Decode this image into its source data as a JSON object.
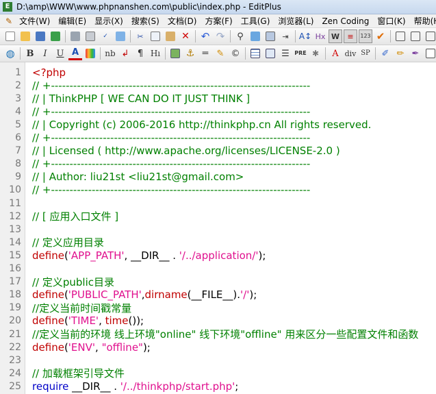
{
  "window": {
    "title": "D:\\amp\\WWW\\www.phpnanshen.com\\public\\index.php - EditPlus"
  },
  "menu": [
    {
      "label": "文件(W)"
    },
    {
      "label": "编辑(E)"
    },
    {
      "label": "显示(X)"
    },
    {
      "label": "搜索(S)"
    },
    {
      "label": "文档(D)"
    },
    {
      "label": "方案(F)"
    },
    {
      "label": "工具(G)"
    },
    {
      "label": "浏览器(L)"
    },
    {
      "label": "Zen Coding"
    },
    {
      "label": "窗口(K)"
    },
    {
      "label": "帮助(H)"
    }
  ],
  "toolbar2_text": {
    "bold": "B",
    "italic": "I",
    "underline": "U",
    "font_color": "A",
    "nbsp": "nb",
    "pilcrow": "¶",
    "heading": "Hı",
    "pre": "PRE",
    "hx": "Hx",
    "div": "div",
    "sp": "SP"
  },
  "icons": {
    "app": "editplus-app-icon",
    "new": "new-file-icon",
    "open": "open-folder-icon",
    "save": "save-icon",
    "save_all": "save-all-icon",
    "print": "print-icon",
    "print_preview": "print-preview-icon",
    "spell": "spellcheck-icon",
    "cut": "cut-icon",
    "copy": "copy-icon",
    "paste": "paste-icon",
    "delete": "delete-icon",
    "undo": "undo-icon",
    "redo": "redo-icon",
    "find": "find-icon",
    "replace": "replace-icon",
    "browser": "browser-icon"
  },
  "colors": {
    "comment": "#008000",
    "keyword": "#c00000",
    "string": "#e0108e",
    "blue_kw": "#0000c8"
  },
  "code_lines": [
    {
      "n": "1",
      "parts": [
        {
          "t": "<?php",
          "c": "red"
        }
      ]
    },
    {
      "n": "2",
      "parts": [
        {
          "t": "// +----------------------------------------------------------------------",
          "c": "green"
        }
      ]
    },
    {
      "n": "3",
      "parts": [
        {
          "t": "// | ThinkPHP [ WE CAN DO IT JUST THINK ]",
          "c": "green"
        }
      ]
    },
    {
      "n": "4",
      "parts": [
        {
          "t": "// +----------------------------------------------------------------------",
          "c": "green"
        }
      ]
    },
    {
      "n": "5",
      "parts": [
        {
          "t": "// | Copyright (c) 2006-2016 http://thinkphp.cn All rights reserved.",
          "c": "green"
        }
      ]
    },
    {
      "n": "6",
      "parts": [
        {
          "t": "// +----------------------------------------------------------------------",
          "c": "green"
        }
      ]
    },
    {
      "n": "7",
      "parts": [
        {
          "t": "// | Licensed ( http://www.apache.org/licenses/LICENSE-2.0 )",
          "c": "green"
        }
      ]
    },
    {
      "n": "8",
      "parts": [
        {
          "t": "// +----------------------------------------------------------------------",
          "c": "green"
        }
      ]
    },
    {
      "n": "9",
      "parts": [
        {
          "t": "// | Author: liu21st <liu21st@gmail.com>",
          "c": "green"
        }
      ]
    },
    {
      "n": "10",
      "parts": [
        {
          "t": "// +----------------------------------------------------------------------",
          "c": "green"
        }
      ]
    },
    {
      "n": "11",
      "parts": []
    },
    {
      "n": "12",
      "parts": [
        {
          "t": "// [ 应用入口文件 ]",
          "c": "green"
        }
      ]
    },
    {
      "n": "13",
      "parts": []
    },
    {
      "n": "14",
      "parts": [
        {
          "t": "// 定义应用目录",
          "c": "green"
        }
      ]
    },
    {
      "n": "15",
      "parts": [
        {
          "t": "define",
          "c": "red"
        },
        {
          "t": "(",
          "c": "black"
        },
        {
          "t": "'APP_PATH'",
          "c": "magenta"
        },
        {
          "t": ", __DIR__ . ",
          "c": "black"
        },
        {
          "t": "'/../application/'",
          "c": "magenta"
        },
        {
          "t": ");",
          "c": "black"
        }
      ]
    },
    {
      "n": "16",
      "parts": []
    },
    {
      "n": "17",
      "parts": [
        {
          "t": "// 定义public目录",
          "c": "green"
        }
      ]
    },
    {
      "n": "18",
      "parts": [
        {
          "t": "define",
          "c": "red"
        },
        {
          "t": "(",
          "c": "black"
        },
        {
          "t": "'PUBLIC_PATH'",
          "c": "magenta"
        },
        {
          "t": ",",
          "c": "black"
        },
        {
          "t": "dirname",
          "c": "red"
        },
        {
          "t": "(__FILE__).",
          "c": "black"
        },
        {
          "t": "'/'",
          "c": "magenta"
        },
        {
          "t": ");",
          "c": "black"
        }
      ]
    },
    {
      "n": "19",
      "parts": [
        {
          "t": "//定义当前时间戳常量",
          "c": "green"
        }
      ]
    },
    {
      "n": "20",
      "parts": [
        {
          "t": "define",
          "c": "red"
        },
        {
          "t": "(",
          "c": "black"
        },
        {
          "t": "'TIME'",
          "c": "magenta"
        },
        {
          "t": ", ",
          "c": "black"
        },
        {
          "t": "time",
          "c": "red"
        },
        {
          "t": "());",
          "c": "black"
        }
      ]
    },
    {
      "n": "21",
      "parts": [
        {
          "t": "//定义当前的环境 线上环境\"online\" 线下环境\"offline\" 用来区分一些配置文件和函数",
          "c": "green"
        }
      ]
    },
    {
      "n": "22",
      "parts": [
        {
          "t": "define",
          "c": "red"
        },
        {
          "t": "(",
          "c": "black"
        },
        {
          "t": "'ENV'",
          "c": "magenta"
        },
        {
          "t": ", ",
          "c": "black"
        },
        {
          "t": "\"offline\"",
          "c": "magenta"
        },
        {
          "t": ");",
          "c": "black"
        }
      ]
    },
    {
      "n": "23",
      "parts": []
    },
    {
      "n": "24",
      "parts": [
        {
          "t": "// 加载框架引导文件",
          "c": "green"
        }
      ]
    },
    {
      "n": "25",
      "parts": [
        {
          "t": "require",
          "c": "blue"
        },
        {
          "t": " __DIR__ . ",
          "c": "black"
        },
        {
          "t": "'/../thinkphp/start.php'",
          "c": "magenta"
        },
        {
          "t": ";",
          "c": "black"
        }
      ]
    }
  ]
}
